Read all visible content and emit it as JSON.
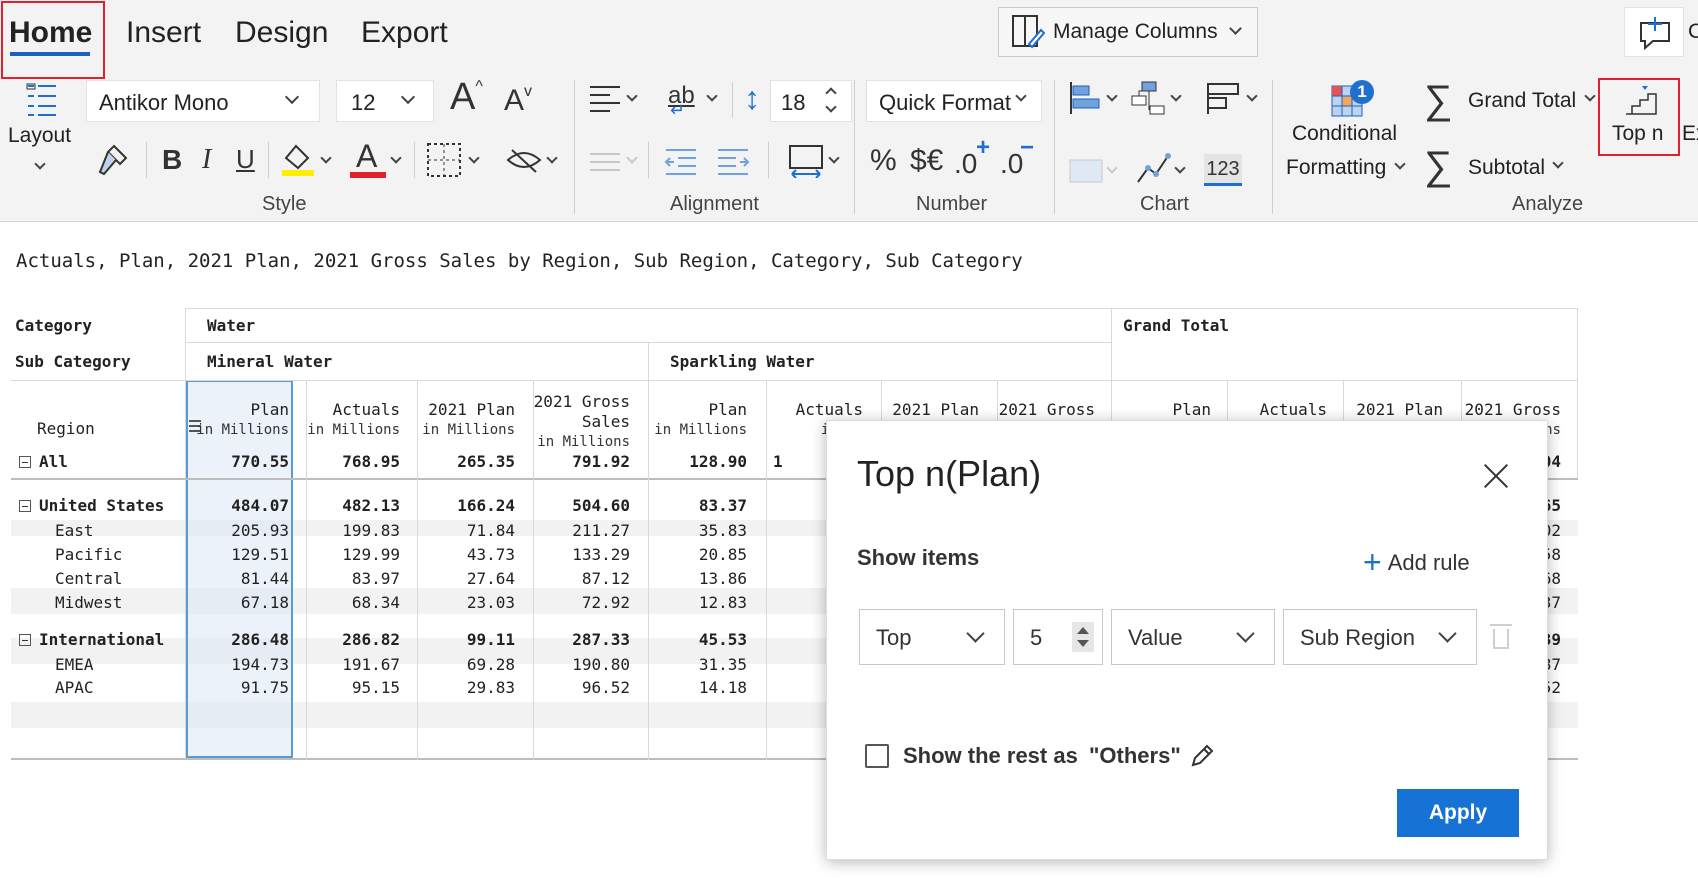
{
  "tabs": {
    "home": "Home",
    "insert": "Insert",
    "design": "Design",
    "export": "Export"
  },
  "toolbar": {
    "manage_columns": "Manage Columns",
    "layout": "Layout",
    "font_family": "Antikor Mono",
    "font_size": "12",
    "row_height": "18",
    "quick_format": "Quick Format",
    "percent": "%",
    "currency": "$€",
    "decimal_inc": ".0",
    "decimal_dec": ".0",
    "number_badge": "123",
    "conditional_formatting_1": "Conditional",
    "conditional_formatting_2": "Formatting",
    "cf_badge": "1",
    "grand_total": "Grand Total",
    "subtotal": "Subtotal",
    "top_n": "Top n",
    "cut_off": "Ex",
    "right_cut": "C",
    "bold": "B",
    "italic": "I",
    "underline": "U",
    "font_color_glyph": "A",
    "groups": {
      "style": "Style",
      "alignment": "Alignment",
      "number": "Number",
      "chart": "Chart",
      "analyze": "Analyze"
    },
    "colors": {
      "highlight_yellow": "#ffee00",
      "font_red": "#e0202a",
      "accent_blue": "#1f6fd0"
    }
  },
  "report_title": "Actuals, Plan, 2021 Plan, 2021 Gross Sales by Region, Sub Region, Category, Sub Category",
  "table": {
    "dim_labels": {
      "category": "Category",
      "sub_category": "Sub Category",
      "region": "Region"
    },
    "categories": {
      "water": "Water",
      "grand_total": "Grand Total"
    },
    "sub_categories": {
      "mineral": "Mineral Water",
      "sparkling": "Sparkling Water"
    },
    "columns": [
      {
        "name": "Plan",
        "unit": "in Millions"
      },
      {
        "name": "Actuals",
        "unit": "in Millions"
      },
      {
        "name": "2021 Plan",
        "unit": "in Millions"
      },
      {
        "name": "2021 Gross Sales",
        "unit": "in Millions"
      },
      {
        "name": "Plan",
        "unit": "in Millions"
      },
      {
        "name": "Actuals",
        "unit": "in Mi"
      },
      {
        "name": "2021 Plan",
        "unit": ""
      },
      {
        "name": "2021 Gross",
        "unit": ""
      },
      {
        "name": "Plan",
        "unit": ""
      },
      {
        "name": "Actuals",
        "unit": ""
      },
      {
        "name": "2021 Plan",
        "unit": ""
      },
      {
        "name": "2021 Gross",
        "unit": "les ons"
      }
    ],
    "rows": [
      {
        "label": "All",
        "values": [
          "770.55",
          "768.95",
          "265.35",
          "791.92",
          "128.90",
          "1"
        ],
        "tail": "04"
      },
      {
        "label": "United States",
        "values": [
          "484.07",
          "482.13",
          "166.24",
          "504.60",
          "83.37"
        ],
        "tail": "65"
      },
      {
        "label": "East",
        "values": [
          "205.93",
          "199.83",
          "71.84",
          "211.27",
          "35.83"
        ],
        "tail": "02"
      },
      {
        "label": "Pacific",
        "values": [
          "129.51",
          "129.99",
          "43.73",
          "133.29",
          "20.85"
        ],
        "tail": "58"
      },
      {
        "label": "Central",
        "values": [
          "81.44",
          "83.97",
          "27.64",
          "87.12",
          "13.86"
        ],
        "tail": "68"
      },
      {
        "label": "Midwest",
        "values": [
          "67.18",
          "68.34",
          "23.03",
          "72.92",
          "12.83"
        ],
        "tail": "37"
      },
      {
        "label": "International",
        "values": [
          "286.48",
          "286.82",
          "99.11",
          "287.33",
          "45.53"
        ],
        "tail": "39"
      },
      {
        "label": "EMEA",
        "values": [
          "194.73",
          "191.67",
          "69.28",
          "190.80",
          "31.35"
        ],
        "tail": "87"
      },
      {
        "label": "APAC",
        "values": [
          "91.75",
          "95.15",
          "29.83",
          "96.52",
          "14.18"
        ],
        "tail": "52"
      }
    ]
  },
  "dialog": {
    "title": "Top n(Plan)",
    "show_items": "Show items",
    "add_rule": "Add rule",
    "rule": {
      "direction": "Top",
      "count": "5",
      "measure": "Value",
      "dimension": "Sub Region"
    },
    "others_label": "Show the rest as",
    "others_value": "\"Others\"",
    "others_checked": false,
    "apply": "Apply"
  }
}
